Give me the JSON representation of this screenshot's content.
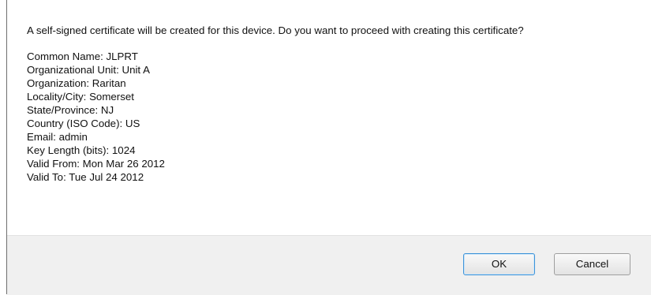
{
  "dialog": {
    "message": "A self-signed certificate will be created for this device. Do you want to proceed with creating this certificate?",
    "fields": [
      "Common Name: JLPRT",
      "Organizational Unit: Unit A",
      "Organization: Raritan",
      "Locality/City: Somerset",
      "State/Province: NJ",
      "Country (ISO Code): US",
      "Email: admin",
      "Key Length (bits): 1024",
      "Valid From: Mon Mar 26 2012",
      "Valid To: Tue Jul 24 2012"
    ],
    "buttons": {
      "ok_label": "OK",
      "cancel_label": "Cancel"
    }
  }
}
